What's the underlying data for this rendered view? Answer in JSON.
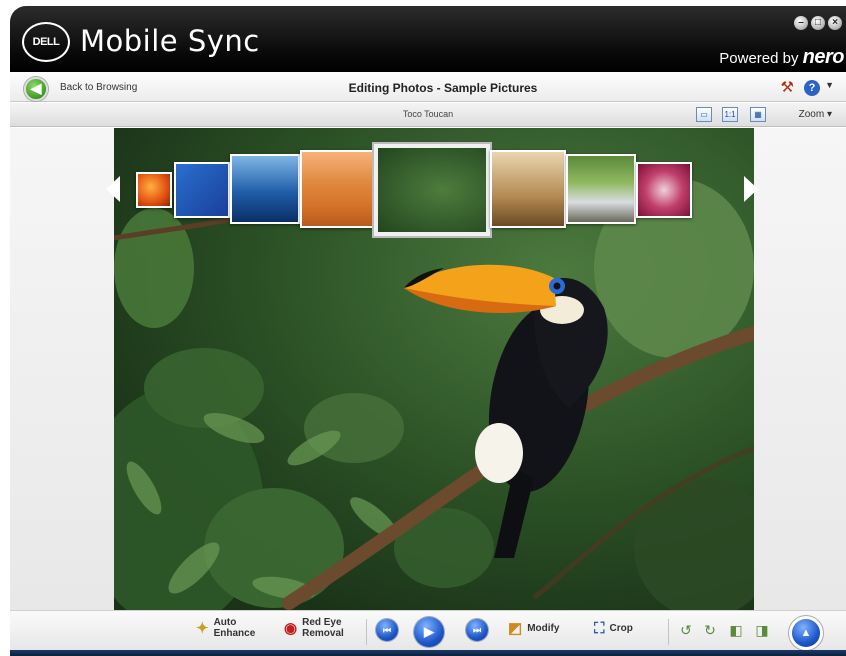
{
  "app": {
    "brand_logo_text": "DELL",
    "title": "Mobile Sync",
    "powered_by": "Powered by",
    "powered_brand": "nero"
  },
  "window_controls": [
    "–",
    "□",
    "×"
  ],
  "nav": {
    "back_label": "Back to Browsing",
    "page_title": "Editing Photos - Sample Pictures",
    "help": "?"
  },
  "photo_bar": {
    "photo_name": "Toco Toucan",
    "zoom_label": "Zoom ▾"
  },
  "thumbnails": [
    {
      "name": "Autumn Leaves"
    },
    {
      "name": "Green Sea Turtle"
    },
    {
      "name": "Humpback Whale"
    },
    {
      "name": "Oryx Antelope"
    },
    {
      "name": "Toco Toucan",
      "selected": true
    },
    {
      "name": "Tree"
    },
    {
      "name": "Waterfall"
    },
    {
      "name": "Frangipani Flowers"
    }
  ],
  "toolbar": {
    "auto_enhance": "Auto\nEnhance",
    "red_eye": "Red Eye\nRemoval",
    "modify": "Modify",
    "crop": "Crop"
  },
  "colors": {
    "accent": "#1e57c9",
    "back_green": "#3a9a20",
    "titlebar": "#000000"
  }
}
